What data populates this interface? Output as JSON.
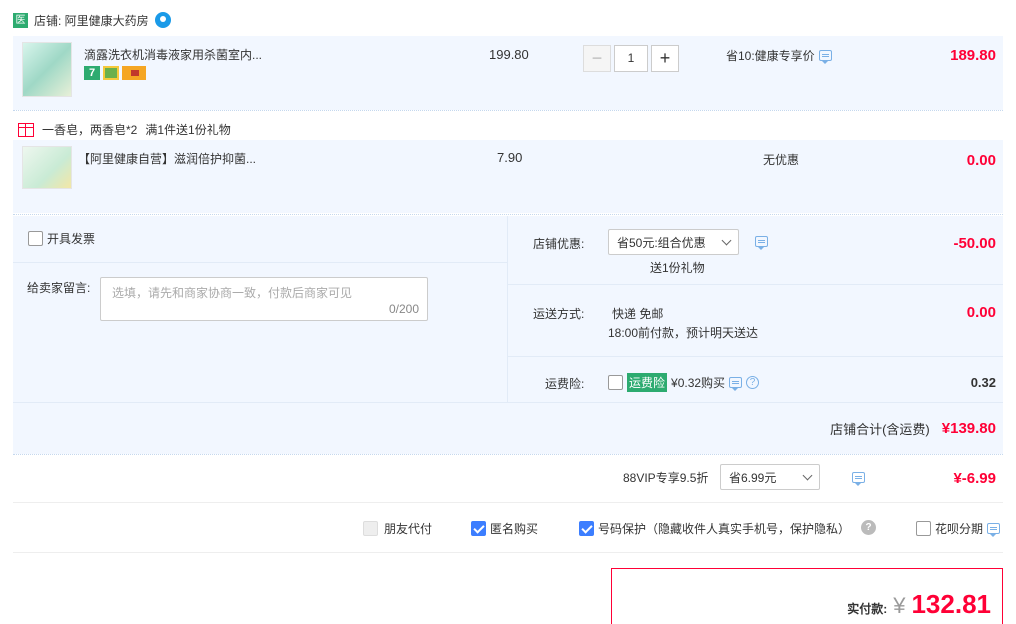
{
  "shop": {
    "badge": "医",
    "name": "店铺: 阿里健康大药房",
    "wang_icon": "wangwang-icon"
  },
  "items": [
    {
      "title": "滴露洗衣机消毒液家用杀菌室内...",
      "unit_price": "199.80",
      "quantity": "1",
      "promo": "省10:健康专享价",
      "total": "189.80",
      "tag_seven": "7"
    },
    {
      "title": "【阿里健康自营】滋润倍护抑菌...",
      "unit_price": "7.90",
      "promo": "无优惠",
      "total": "0.00"
    }
  ],
  "gift": {
    "text": "一香皂，两香皂*2",
    "rule": "满1件送1份礼物"
  },
  "invoice": {
    "label": "开具发票"
  },
  "message": {
    "label": "给卖家留言:",
    "placeholder": "选填，请先和商家协商一致，付款后商家可见",
    "counter": "0/200"
  },
  "store_discount": {
    "label": "店铺优惠:",
    "selected": "省50元:组合优惠",
    "sub": "送1份礼物",
    "amount": "-50.00"
  },
  "shipping": {
    "label": "运送方式:",
    "method": "快递 免邮",
    "eta": "18:00前付款，预计明天送达",
    "amount": "0.00"
  },
  "insurance": {
    "label": "运费险:",
    "badge": "运费险",
    "price": "¥0.32购买",
    "amount": "0.32"
  },
  "store_total": {
    "label": "店铺合计(含运费)",
    "amount": "¥139.80"
  },
  "vip": {
    "label": "88VIP专享9.5折",
    "selected": "省6.99元",
    "amount": "¥-6.99"
  },
  "options": {
    "friend_pay": "朋友代付",
    "anonymous": "匿名购买",
    "number_protect": "号码保护（隐藏收件人真实手机号，保护隐私）",
    "huabei": "花呗分期"
  },
  "payment": {
    "label": "实付款:",
    "currency": "¥",
    "amount": "132.81"
  },
  "colors": {
    "accent_red": "#ff0036",
    "light_blue": "#f2f7ff",
    "check_blue": "#3c7eff",
    "shop_green": "#2dab70"
  }
}
